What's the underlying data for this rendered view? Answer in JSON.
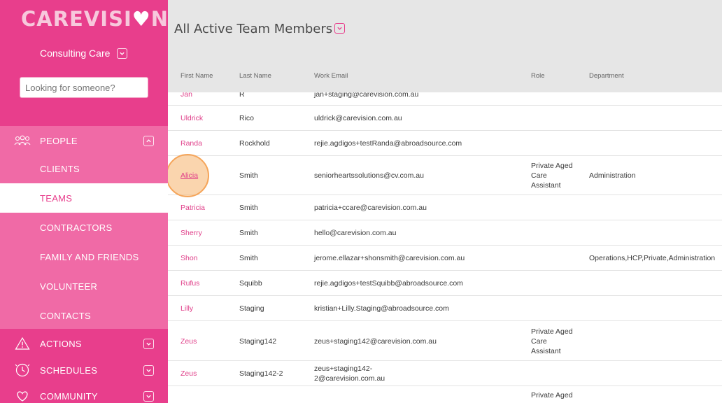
{
  "brand": {
    "logo_text_main": "CAREVISI",
    "logo_text_end": "N",
    "org_name": "Consulting Care"
  },
  "search": {
    "placeholder": "Looking for someone?"
  },
  "nav": {
    "people": "PEOPLE",
    "people_items": [
      "CLIENTS",
      "TEAMS",
      "CONTRACTORS",
      "FAMILY AND FRIENDS",
      "VOLUNTEER",
      "CONTACTS"
    ],
    "active_item": "TEAMS",
    "actions": "ACTIONS",
    "schedules": "SCHEDULES",
    "community": "COMMUNITY"
  },
  "page": {
    "title": "All Active Team Members"
  },
  "table": {
    "headers": [
      "First Name",
      "Last Name",
      "Work Email",
      "Role",
      "Department"
    ],
    "rows": [
      {
        "first": "Jan",
        "last": "R",
        "email": "jan+staging@carevision.com.au",
        "role": "",
        "dept": ""
      },
      {
        "first": "Uldrick",
        "last": "Rico",
        "email": "uldrick@carevision.com.au",
        "role": "",
        "dept": ""
      },
      {
        "first": "Randa",
        "last": "Rockhold",
        "email": "rejie.agdigos+testRanda@abroadsource.com",
        "role": "",
        "dept": ""
      },
      {
        "first": "Alicia",
        "last": "Smith",
        "email": "seniorheartssolutions@cv.com.au",
        "role": "Private Aged Care Assistant",
        "dept": "Administration"
      },
      {
        "first": "Patricia",
        "last": "Smith",
        "email": "patricia+ccare@carevision.com.au",
        "role": "",
        "dept": ""
      },
      {
        "first": "Sherry",
        "last": "Smith",
        "email": "hello@carevision.com.au",
        "role": "",
        "dept": ""
      },
      {
        "first": "Shon",
        "last": "Smith",
        "email": "jerome.ellazar+shonsmith@carevision.com.au",
        "role": "",
        "dept": "Operations,HCP,Private,Administration"
      },
      {
        "first": "Rufus",
        "last": "Squibb",
        "email": "rejie.agdigos+testSquibb@abroadsource.com",
        "role": "",
        "dept": ""
      },
      {
        "first": "Lilly",
        "last": "Staging",
        "email": "kristian+Lilly.Staging@abroadsource.com",
        "role": "",
        "dept": ""
      },
      {
        "first": "Zeus",
        "last": "Staging142",
        "email": "zeus+staging142@carevision.com.au",
        "role": "Private Aged Care Assistant",
        "dept": ""
      },
      {
        "first": "Zeus",
        "last": "Staging142-2",
        "email": "zeus+staging142-2@carevision.com.au",
        "role": "",
        "dept": ""
      },
      {
        "first": "",
        "last": "",
        "email": "",
        "role": "Private Aged",
        "dept": ""
      }
    ]
  },
  "colors": {
    "brand_pink": "#e83e8c",
    "light_pink": "#f06aa6",
    "header_bg": "#e6e6e6"
  }
}
